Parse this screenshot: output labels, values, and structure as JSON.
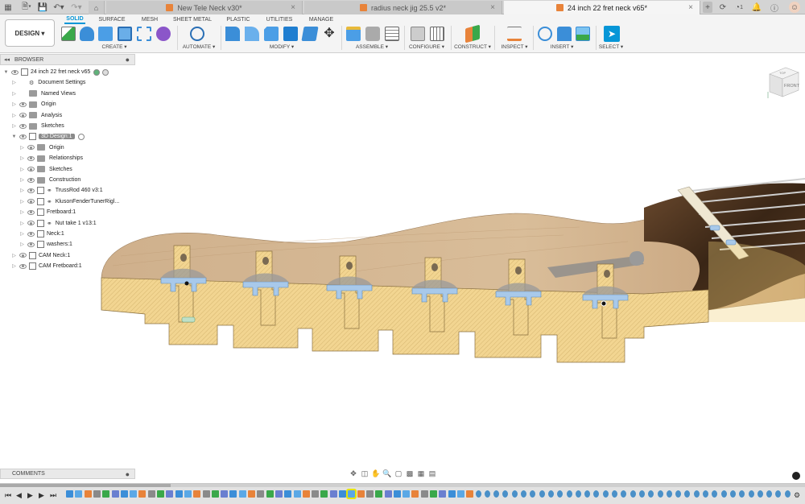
{
  "tabs": [
    {
      "label": "New Tele Neck v30*",
      "active": false
    },
    {
      "label": "radius neck jig 25.5 v2*",
      "active": false
    },
    {
      "label": "24 inch 22 fret neck v65*",
      "active": true
    }
  ],
  "workspace": {
    "label": "DESIGN ▾"
  },
  "ribbon_tabs": [
    "SOLID",
    "SURFACE",
    "MESH",
    "SHEET METAL",
    "PLASTIC",
    "UTILITIES",
    "MANAGE"
  ],
  "ribbon_groups": [
    "CREATE ▾",
    "AUTOMATE ▾",
    "MODIFY ▾",
    "ASSEMBLE ▾",
    "CONFIGURE ▾",
    "CONSTRUCT ▾",
    "INSPECT ▾",
    "INSERT ▾",
    "SELECT ▾"
  ],
  "browser": {
    "title": "BROWSER",
    "items": [
      {
        "label": "24 inch 22 fret neck v65",
        "depth": 0,
        "kind": "root"
      },
      {
        "label": "Document Settings",
        "depth": 1,
        "kind": "gear"
      },
      {
        "label": "Named Views",
        "depth": 1,
        "kind": "folder-noeye"
      },
      {
        "label": "Origin",
        "depth": 1,
        "kind": "folder"
      },
      {
        "label": "Analysis",
        "depth": 1,
        "kind": "folder"
      },
      {
        "label": "Sketches",
        "depth": 1,
        "kind": "folder"
      },
      {
        "label": "3D Design:1",
        "depth": 1,
        "kind": "component-active"
      },
      {
        "label": "Origin",
        "depth": 2,
        "kind": "folder"
      },
      {
        "label": "Relationships",
        "depth": 2,
        "kind": "folder"
      },
      {
        "label": "Sketches",
        "depth": 2,
        "kind": "folder"
      },
      {
        "label": "Construction",
        "depth": 2,
        "kind": "folder"
      },
      {
        "label": "TrussRod 460 v3:1",
        "depth": 2,
        "kind": "link"
      },
      {
        "label": "KlusonFenderTunerRigl...",
        "depth": 2,
        "kind": "link"
      },
      {
        "label": "Fretboard:1",
        "depth": 2,
        "kind": "component"
      },
      {
        "label": "Nut take 1 v13:1",
        "depth": 2,
        "kind": "link"
      },
      {
        "label": "Neck:1",
        "depth": 2,
        "kind": "component"
      },
      {
        "label": "washers:1",
        "depth": 2,
        "kind": "component"
      },
      {
        "label": "CAM Neck:1",
        "depth": 1,
        "kind": "component"
      },
      {
        "label": "CAM Fretboard:1",
        "depth": 1,
        "kind": "component"
      }
    ]
  },
  "comments": {
    "label": "COMMENTS"
  },
  "viewcube": {
    "top": "TOP",
    "front": "FRONT"
  },
  "colors": {
    "accent": "#0696d7",
    "orange": "#e8833a",
    "section": "#f2d591",
    "wood": "#d6b896"
  }
}
